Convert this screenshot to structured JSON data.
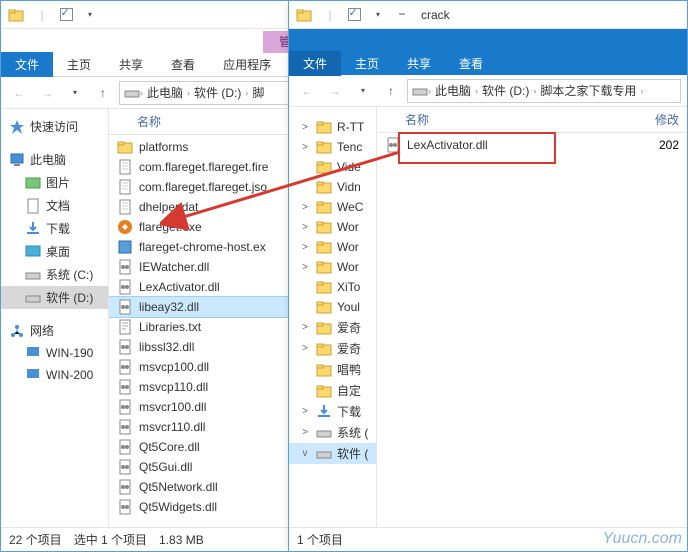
{
  "w1": {
    "manage_tab": "管理",
    "ribbon": {
      "file": "文件",
      "home": "主页",
      "share": "共享",
      "view": "查看",
      "app": "应用程序"
    },
    "breadcrumb": [
      "此电脑",
      "软件 (D:)",
      "脚"
    ],
    "nav": {
      "quick": "快速访问",
      "thispc": "此电脑",
      "pictures": "图片",
      "docs": "文档",
      "downloads": "下载",
      "desktop": "桌面",
      "sysc": "系统 (C:)",
      "softd": "软件 (D:)",
      "network": "网络",
      "win190": "WIN-190",
      "win200": "WIN-200"
    },
    "col_name": "名称",
    "files": [
      {
        "n": "platforms",
        "t": "folder"
      },
      {
        "n": "com.flareget.flareget.fire",
        "t": "file"
      },
      {
        "n": "com.flareget.flareget.jso",
        "t": "file"
      },
      {
        "n": "dhelper.dat",
        "t": "file"
      },
      {
        "n": "flareget.exe",
        "t": "exe"
      },
      {
        "n": "flareget-chrome-host.ex",
        "t": "exe2"
      },
      {
        "n": "IEWatcher.dll",
        "t": "dll"
      },
      {
        "n": "LexActivator.dll",
        "t": "dll"
      },
      {
        "n": "libeay32.dll",
        "t": "dll",
        "sel": true
      },
      {
        "n": "Libraries.txt",
        "t": "txt"
      },
      {
        "n": "libssl32.dll",
        "t": "dll"
      },
      {
        "n": "msvcp100.dll",
        "t": "dll"
      },
      {
        "n": "msvcp110.dll",
        "t": "dll"
      },
      {
        "n": "msvcr100.dll",
        "t": "dll"
      },
      {
        "n": "msvcr110.dll",
        "t": "dll"
      },
      {
        "n": "Qt5Core.dll",
        "t": "dll"
      },
      {
        "n": "Qt5Gui.dll",
        "t": "dll"
      },
      {
        "n": "Qt5Network.dll",
        "t": "dll"
      },
      {
        "n": "Qt5Widgets.dll",
        "t": "dll"
      }
    ],
    "status": {
      "count": "22 个项目",
      "sel": "选中 1 个项目",
      "size": "1.83 MB"
    }
  },
  "w2": {
    "title": "crack",
    "ribbon": {
      "file": "文件",
      "home": "主页",
      "share": "共享",
      "view": "查看"
    },
    "breadcrumb": [
      "此电脑",
      "软件 (D:)",
      "脚本之家下载专用"
    ],
    "col_name": "名称",
    "col_mod": "修改",
    "tree": [
      {
        "n": "R-TT",
        "exp": ">"
      },
      {
        "n": "Tenc",
        "exp": ">"
      },
      {
        "n": "Vide",
        "exp": ""
      },
      {
        "n": "Vidn",
        "exp": ""
      },
      {
        "n": "WeC",
        "exp": ">"
      },
      {
        "n": "Wor",
        "exp": ">"
      },
      {
        "n": "Wor",
        "exp": ">"
      },
      {
        "n": "Wor",
        "exp": ">"
      },
      {
        "n": "XiTo",
        "exp": ""
      },
      {
        "n": "Youl",
        "exp": ""
      },
      {
        "n": "爱奇",
        "exp": ">"
      },
      {
        "n": "爱奇",
        "exp": ">"
      },
      {
        "n": "唱鸭",
        "exp": ""
      },
      {
        "n": "自定",
        "exp": ""
      }
    ],
    "tree_special": [
      {
        "n": "下载",
        "ico": "download",
        "exp": ">"
      },
      {
        "n": "系统 (",
        "ico": "drive",
        "exp": ">"
      },
      {
        "n": "软件 (",
        "ico": "drive",
        "exp": "v",
        "sel": true
      }
    ],
    "file": {
      "n": "LexActivator.dll",
      "date": "202"
    },
    "status": {
      "count": "1 个项目"
    }
  },
  "watermark": "Yuucn.com"
}
